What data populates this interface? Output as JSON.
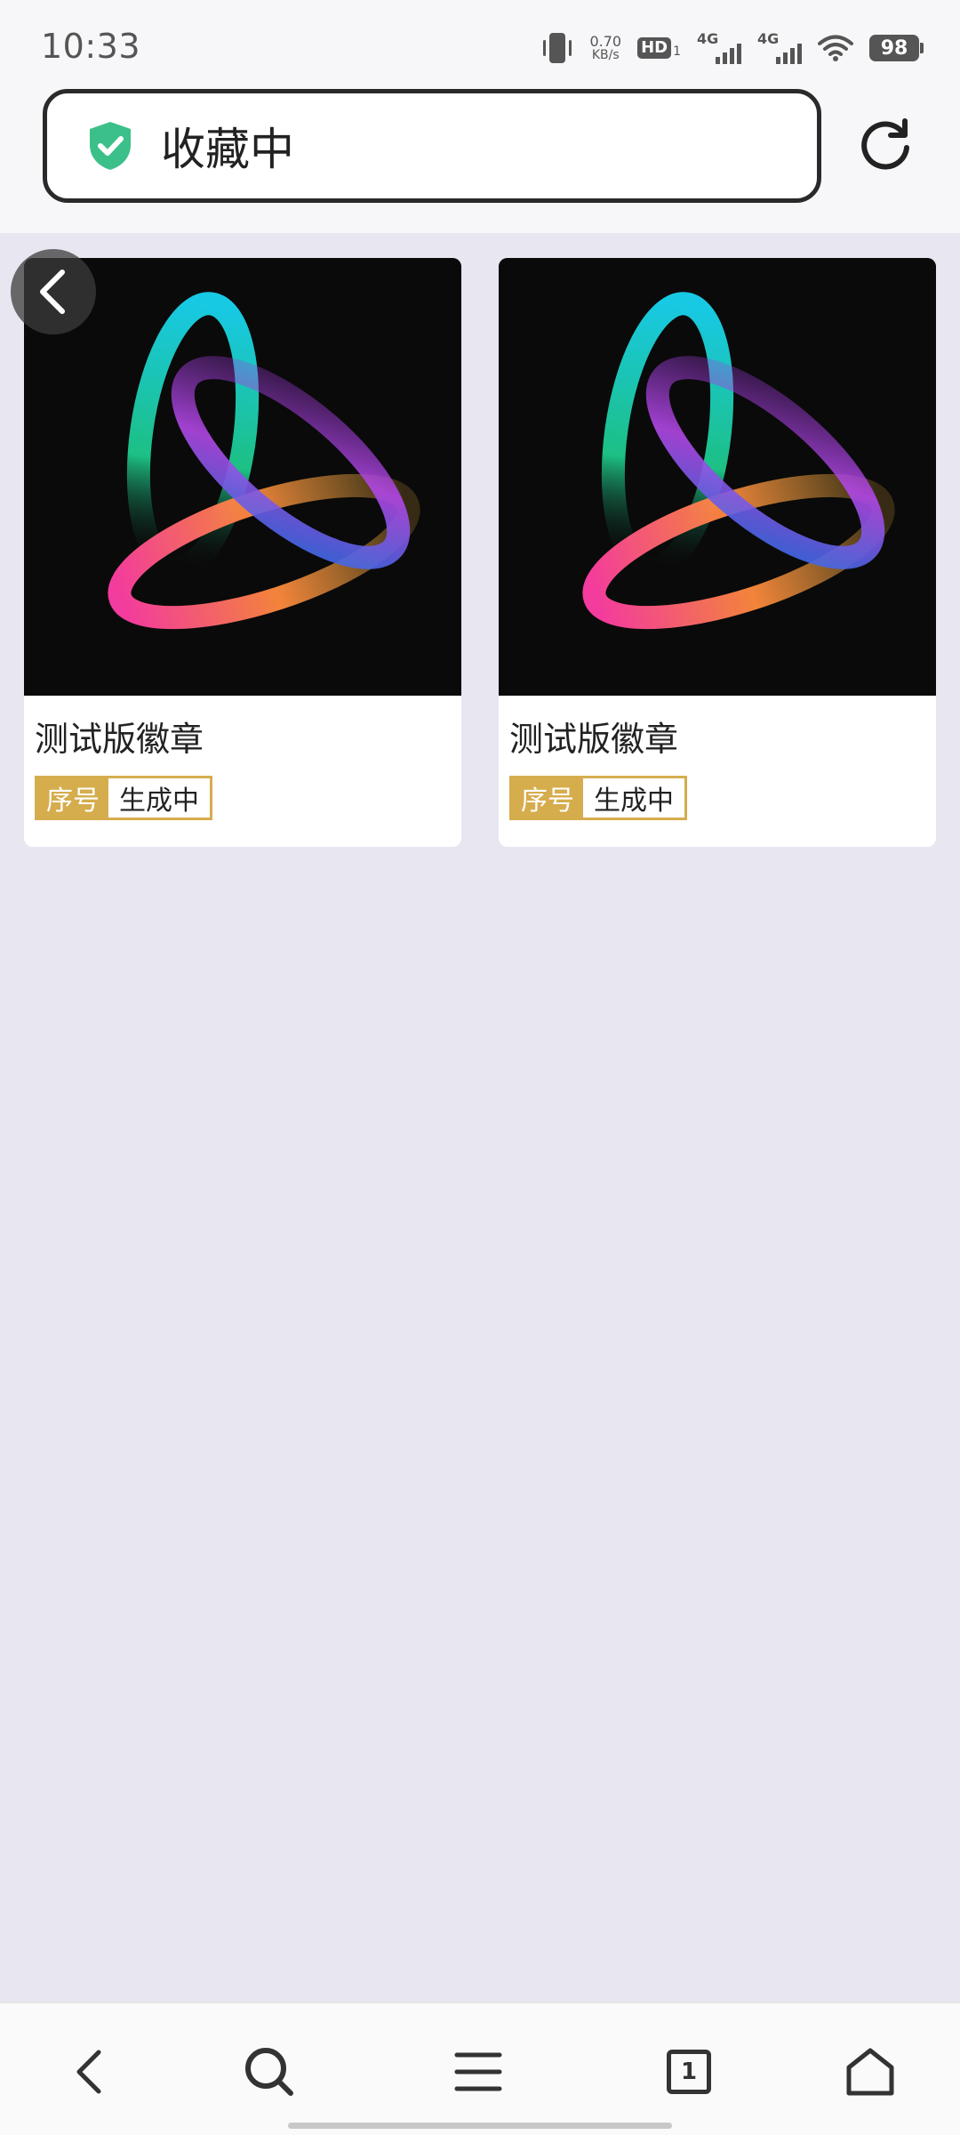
{
  "status_bar": {
    "time": "10:33",
    "net_speed_value": "0.70",
    "net_speed_unit": "KB/s",
    "hd_label": "HD",
    "hd_sub": "1",
    "sim1_label": "4G",
    "sim2_label": "4G",
    "battery": "98"
  },
  "address_bar": {
    "title": "收藏中",
    "shield_color": "#3cc08a"
  },
  "cards": [
    {
      "title": "测试版徽章",
      "tag_label": "序号",
      "tag_value": "生成中"
    },
    {
      "title": "测试版徽章",
      "tag_label": "序号",
      "tag_value": "生成中"
    }
  ],
  "bottom_nav": {
    "tabs_count": "1",
    "items": [
      "back-icon",
      "search-icon",
      "menu-icon",
      "tabs-icon",
      "home-icon"
    ]
  },
  "colors": {
    "tag_gold": "#d6ad4d",
    "background": "#e8e6f0"
  }
}
